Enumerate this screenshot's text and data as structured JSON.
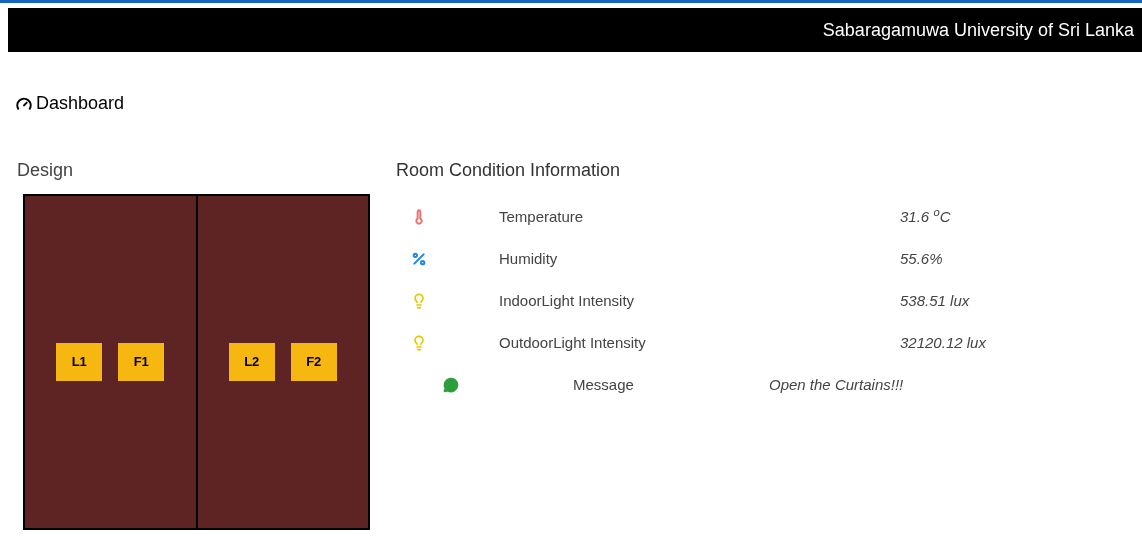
{
  "header": {
    "title": "Sabaragamuwa University of Sri Lanka"
  },
  "page_title": "Dashboard",
  "design": {
    "title": "Design",
    "rooms": [
      {
        "devices": [
          "L1",
          "F1"
        ]
      },
      {
        "devices": [
          "L2",
          "F2"
        ]
      }
    ]
  },
  "info": {
    "title": "Room Condition Information",
    "rows": [
      {
        "kind": "temperature",
        "label": "Temperature",
        "value": "31.6 $^{o}$C"
      },
      {
        "kind": "humidity",
        "label": "Humidity",
        "value": "55.6%"
      },
      {
        "kind": "light",
        "label": "IndoorLight Intensity",
        "value": "538.51 lux"
      },
      {
        "kind": "light",
        "label": "OutdoorLight Intensity",
        "value": "32120.12 lux"
      }
    ],
    "message": {
      "label": "Message",
      "value": "Open the Curtains!!!"
    }
  }
}
